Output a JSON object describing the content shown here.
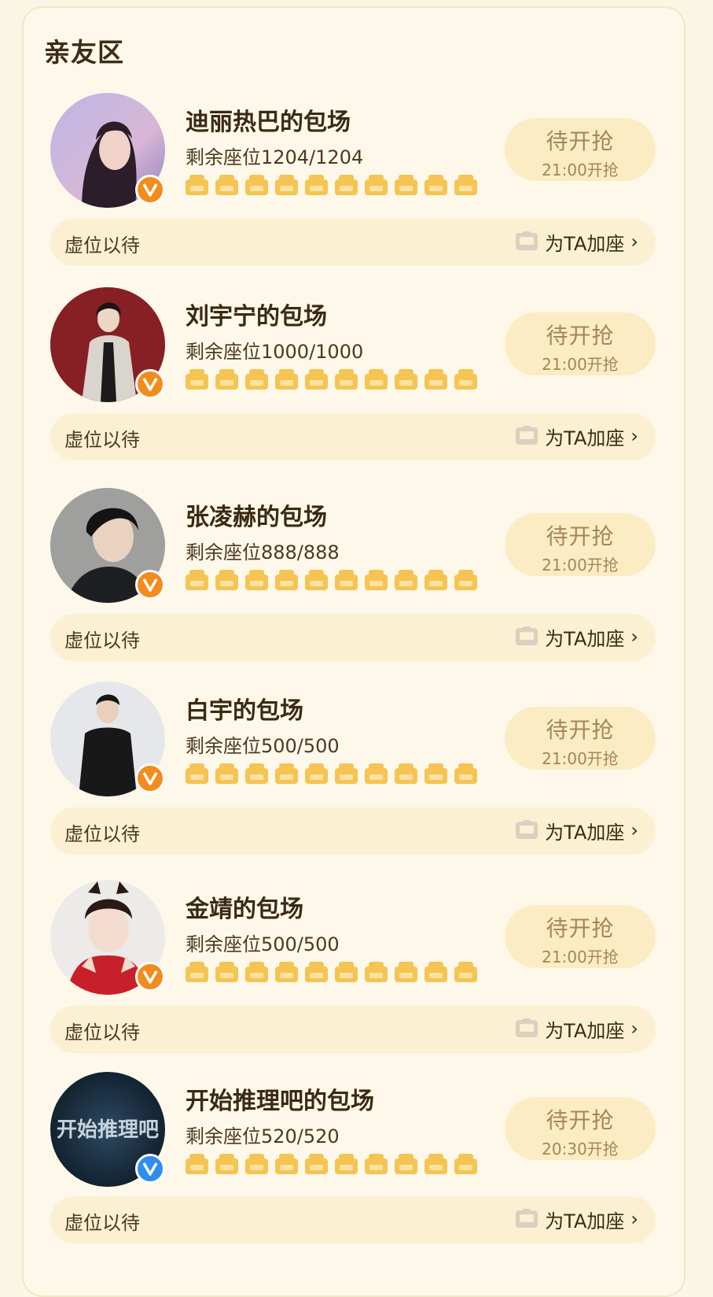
{
  "section": {
    "title": "亲友区"
  },
  "theme": {
    "accent": "#f5c452",
    "badge_orange": "#f28c1c",
    "badge_blue": "#2f8cf0"
  },
  "entries": [
    {
      "title": "迪丽热巴的包场",
      "remaining": "剩余座位1204/1204",
      "status": "待开抢",
      "time": "21:00开抢",
      "bar_text": "虚位以待",
      "add_seat": "为TA加座",
      "badge_icon": "vip-v-orange",
      "seats": 10
    },
    {
      "title": "刘宇宁的包场",
      "remaining": "剩余座位1000/1000",
      "status": "待开抢",
      "time": "21:00开抢",
      "bar_text": "虚位以待",
      "add_seat": "为TA加座",
      "badge_icon": "vip-v-orange",
      "seats": 10
    },
    {
      "title": "张凌赫的包场",
      "remaining": "剩余座位888/888",
      "status": "待开抢",
      "time": "21:00开抢",
      "bar_text": "虚位以待",
      "add_seat": "为TA加座",
      "badge_icon": "vip-v-orange",
      "seats": 10
    },
    {
      "title": "白宇的包场",
      "remaining": "剩余座位500/500",
      "status": "待开抢",
      "time": "21:00开抢",
      "bar_text": "虚位以待",
      "add_seat": "为TA加座",
      "badge_icon": "vip-v-orange",
      "seats": 10
    },
    {
      "title": "金靖的包场",
      "remaining": "剩余座位500/500",
      "status": "待开抢",
      "time": "21:00开抢",
      "bar_text": "虚位以待",
      "add_seat": "为TA加座",
      "badge_icon": "vip-v-orange",
      "seats": 10
    },
    {
      "title": "开始推理吧的包场",
      "remaining": "剩余座位520/520",
      "status": "待开抢",
      "time": "20:30开抢",
      "bar_text": "虚位以待",
      "add_seat": "为TA加座",
      "badge_icon": "vip-v-blue",
      "seats": 10,
      "avatar_text": "开始推理吧"
    }
  ]
}
